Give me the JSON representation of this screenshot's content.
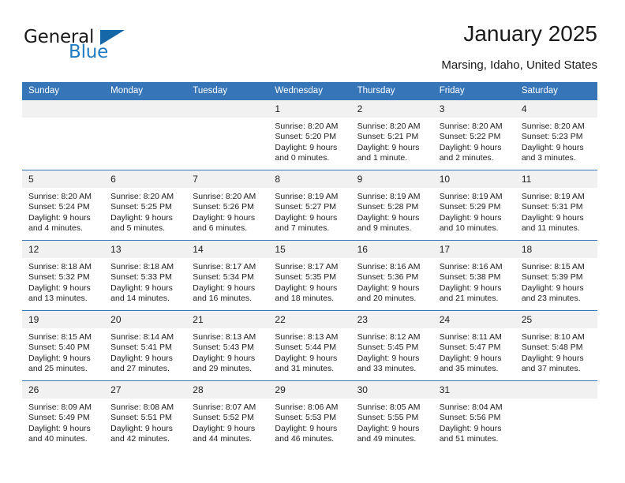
{
  "brand": {
    "name_top": "General",
    "name_bottom": "Blue",
    "triangle_icon": "triangle-icon",
    "color_dark": "#1b1b1b",
    "color_blue": "#1f7bc1",
    "color_triangle": "#1567a8"
  },
  "header": {
    "title": "January 2025",
    "subtitle": "Marsing, Idaho, United States"
  },
  "theme": {
    "header_blue": "#3575b8",
    "daynum_band": "#f1f1f1",
    "text": "#1f1f1f"
  },
  "calendar": {
    "weekday_headers": [
      "Sunday",
      "Monday",
      "Tuesday",
      "Wednesday",
      "Thursday",
      "Friday",
      "Saturday"
    ],
    "weeks": [
      [
        {
          "day": "",
          "sunrise": "",
          "sunset": "",
          "daylight_line1": "",
          "daylight_line2": ""
        },
        {
          "day": "",
          "sunrise": "",
          "sunset": "",
          "daylight_line1": "",
          "daylight_line2": ""
        },
        {
          "day": "",
          "sunrise": "",
          "sunset": "",
          "daylight_line1": "",
          "daylight_line2": ""
        },
        {
          "day": "1",
          "sunrise": "Sunrise: 8:20 AM",
          "sunset": "Sunset: 5:20 PM",
          "daylight_line1": "Daylight: 9 hours",
          "daylight_line2": "and 0 minutes."
        },
        {
          "day": "2",
          "sunrise": "Sunrise: 8:20 AM",
          "sunset": "Sunset: 5:21 PM",
          "daylight_line1": "Daylight: 9 hours",
          "daylight_line2": "and 1 minute."
        },
        {
          "day": "3",
          "sunrise": "Sunrise: 8:20 AM",
          "sunset": "Sunset: 5:22 PM",
          "daylight_line1": "Daylight: 9 hours",
          "daylight_line2": "and 2 minutes."
        },
        {
          "day": "4",
          "sunrise": "Sunrise: 8:20 AM",
          "sunset": "Sunset: 5:23 PM",
          "daylight_line1": "Daylight: 9 hours",
          "daylight_line2": "and 3 minutes."
        }
      ],
      [
        {
          "day": "5",
          "sunrise": "Sunrise: 8:20 AM",
          "sunset": "Sunset: 5:24 PM",
          "daylight_line1": "Daylight: 9 hours",
          "daylight_line2": "and 4 minutes."
        },
        {
          "day": "6",
          "sunrise": "Sunrise: 8:20 AM",
          "sunset": "Sunset: 5:25 PM",
          "daylight_line1": "Daylight: 9 hours",
          "daylight_line2": "and 5 minutes."
        },
        {
          "day": "7",
          "sunrise": "Sunrise: 8:20 AM",
          "sunset": "Sunset: 5:26 PM",
          "daylight_line1": "Daylight: 9 hours",
          "daylight_line2": "and 6 minutes."
        },
        {
          "day": "8",
          "sunrise": "Sunrise: 8:19 AM",
          "sunset": "Sunset: 5:27 PM",
          "daylight_line1": "Daylight: 9 hours",
          "daylight_line2": "and 7 minutes."
        },
        {
          "day": "9",
          "sunrise": "Sunrise: 8:19 AM",
          "sunset": "Sunset: 5:28 PM",
          "daylight_line1": "Daylight: 9 hours",
          "daylight_line2": "and 9 minutes."
        },
        {
          "day": "10",
          "sunrise": "Sunrise: 8:19 AM",
          "sunset": "Sunset: 5:29 PM",
          "daylight_line1": "Daylight: 9 hours",
          "daylight_line2": "and 10 minutes."
        },
        {
          "day": "11",
          "sunrise": "Sunrise: 8:19 AM",
          "sunset": "Sunset: 5:31 PM",
          "daylight_line1": "Daylight: 9 hours",
          "daylight_line2": "and 11 minutes."
        }
      ],
      [
        {
          "day": "12",
          "sunrise": "Sunrise: 8:18 AM",
          "sunset": "Sunset: 5:32 PM",
          "daylight_line1": "Daylight: 9 hours",
          "daylight_line2": "and 13 minutes."
        },
        {
          "day": "13",
          "sunrise": "Sunrise: 8:18 AM",
          "sunset": "Sunset: 5:33 PM",
          "daylight_line1": "Daylight: 9 hours",
          "daylight_line2": "and 14 minutes."
        },
        {
          "day": "14",
          "sunrise": "Sunrise: 8:17 AM",
          "sunset": "Sunset: 5:34 PM",
          "daylight_line1": "Daylight: 9 hours",
          "daylight_line2": "and 16 minutes."
        },
        {
          "day": "15",
          "sunrise": "Sunrise: 8:17 AM",
          "sunset": "Sunset: 5:35 PM",
          "daylight_line1": "Daylight: 9 hours",
          "daylight_line2": "and 18 minutes."
        },
        {
          "day": "16",
          "sunrise": "Sunrise: 8:16 AM",
          "sunset": "Sunset: 5:36 PM",
          "daylight_line1": "Daylight: 9 hours",
          "daylight_line2": "and 20 minutes."
        },
        {
          "day": "17",
          "sunrise": "Sunrise: 8:16 AM",
          "sunset": "Sunset: 5:38 PM",
          "daylight_line1": "Daylight: 9 hours",
          "daylight_line2": "and 21 minutes."
        },
        {
          "day": "18",
          "sunrise": "Sunrise: 8:15 AM",
          "sunset": "Sunset: 5:39 PM",
          "daylight_line1": "Daylight: 9 hours",
          "daylight_line2": "and 23 minutes."
        }
      ],
      [
        {
          "day": "19",
          "sunrise": "Sunrise: 8:15 AM",
          "sunset": "Sunset: 5:40 PM",
          "daylight_line1": "Daylight: 9 hours",
          "daylight_line2": "and 25 minutes."
        },
        {
          "day": "20",
          "sunrise": "Sunrise: 8:14 AM",
          "sunset": "Sunset: 5:41 PM",
          "daylight_line1": "Daylight: 9 hours",
          "daylight_line2": "and 27 minutes."
        },
        {
          "day": "21",
          "sunrise": "Sunrise: 8:13 AM",
          "sunset": "Sunset: 5:43 PM",
          "daylight_line1": "Daylight: 9 hours",
          "daylight_line2": "and 29 minutes."
        },
        {
          "day": "22",
          "sunrise": "Sunrise: 8:13 AM",
          "sunset": "Sunset: 5:44 PM",
          "daylight_line1": "Daylight: 9 hours",
          "daylight_line2": "and 31 minutes."
        },
        {
          "day": "23",
          "sunrise": "Sunrise: 8:12 AM",
          "sunset": "Sunset: 5:45 PM",
          "daylight_line1": "Daylight: 9 hours",
          "daylight_line2": "and 33 minutes."
        },
        {
          "day": "24",
          "sunrise": "Sunrise: 8:11 AM",
          "sunset": "Sunset: 5:47 PM",
          "daylight_line1": "Daylight: 9 hours",
          "daylight_line2": "and 35 minutes."
        },
        {
          "day": "25",
          "sunrise": "Sunrise: 8:10 AM",
          "sunset": "Sunset: 5:48 PM",
          "daylight_line1": "Daylight: 9 hours",
          "daylight_line2": "and 37 minutes."
        }
      ],
      [
        {
          "day": "26",
          "sunrise": "Sunrise: 8:09 AM",
          "sunset": "Sunset: 5:49 PM",
          "daylight_line1": "Daylight: 9 hours",
          "daylight_line2": "and 40 minutes."
        },
        {
          "day": "27",
          "sunrise": "Sunrise: 8:08 AM",
          "sunset": "Sunset: 5:51 PM",
          "daylight_line1": "Daylight: 9 hours",
          "daylight_line2": "and 42 minutes."
        },
        {
          "day": "28",
          "sunrise": "Sunrise: 8:07 AM",
          "sunset": "Sunset: 5:52 PM",
          "daylight_line1": "Daylight: 9 hours",
          "daylight_line2": "and 44 minutes."
        },
        {
          "day": "29",
          "sunrise": "Sunrise: 8:06 AM",
          "sunset": "Sunset: 5:53 PM",
          "daylight_line1": "Daylight: 9 hours",
          "daylight_line2": "and 46 minutes."
        },
        {
          "day": "30",
          "sunrise": "Sunrise: 8:05 AM",
          "sunset": "Sunset: 5:55 PM",
          "daylight_line1": "Daylight: 9 hours",
          "daylight_line2": "and 49 minutes."
        },
        {
          "day": "31",
          "sunrise": "Sunrise: 8:04 AM",
          "sunset": "Sunset: 5:56 PM",
          "daylight_line1": "Daylight: 9 hours",
          "daylight_line2": "and 51 minutes."
        },
        {
          "day": "",
          "sunrise": "",
          "sunset": "",
          "daylight_line1": "",
          "daylight_line2": ""
        }
      ]
    ]
  }
}
